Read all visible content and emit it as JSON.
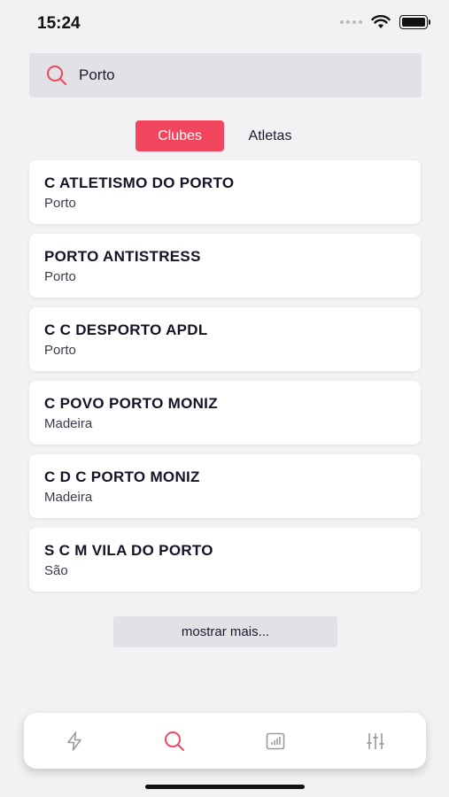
{
  "status": {
    "time": "15:24"
  },
  "search": {
    "value": "Porto",
    "placeholder": ""
  },
  "segments": {
    "clubs": "Clubes",
    "athletes": "Atletas"
  },
  "results": [
    {
      "name": "C ATLETISMO DO PORTO",
      "location": "Porto"
    },
    {
      "name": "PORTO ANTISTRESS",
      "location": "Porto"
    },
    {
      "name": "C C DESPORTO APDL",
      "location": "Porto"
    },
    {
      "name": "C POVO PORTO MONIZ",
      "location": "Madeira"
    },
    {
      "name": "C D C PORTO MONIZ",
      "location": "Madeira"
    },
    {
      "name": "S C M VILA DO PORTO",
      "location": "São"
    }
  ],
  "more_label": "mostrar mais...",
  "tabs": [
    {
      "icon": "lightning-icon",
      "active": false
    },
    {
      "icon": "search-icon",
      "active": true
    },
    {
      "icon": "chart-icon",
      "active": false
    },
    {
      "icon": "sliders-icon",
      "active": false
    }
  ],
  "colors": {
    "accent": "#f2455e",
    "background": "#f2f2f4",
    "inactive_icon": "#9a9aa2"
  }
}
